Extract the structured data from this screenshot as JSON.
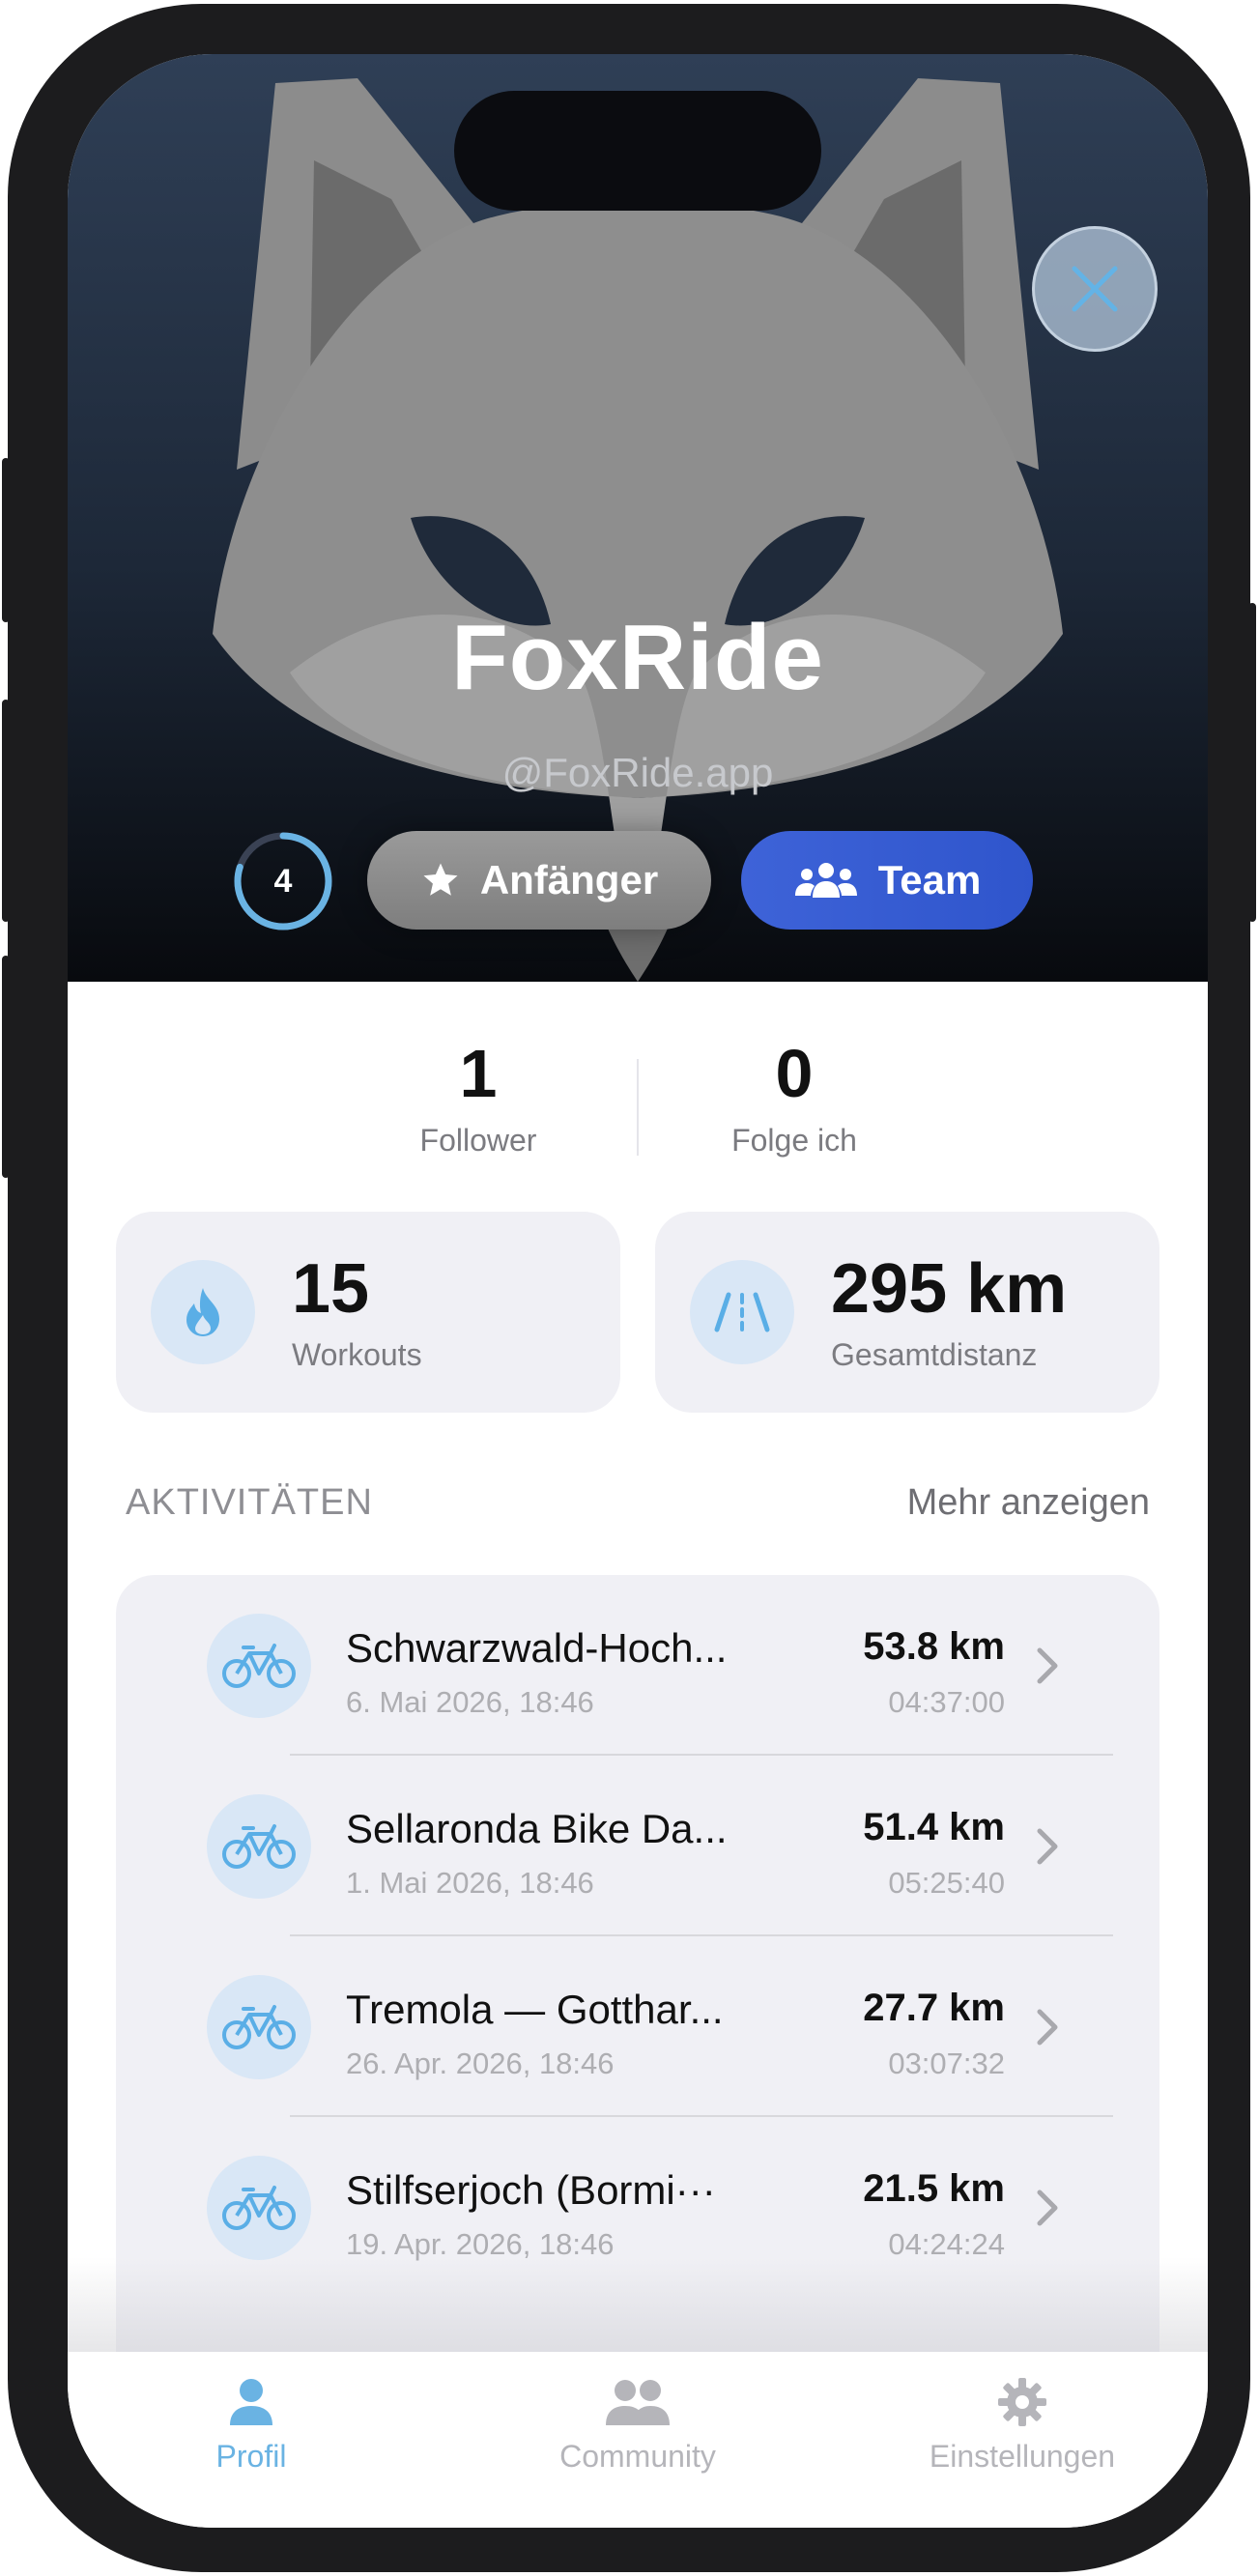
{
  "profile": {
    "name": "FoxRide",
    "handle": "@FoxRide.app",
    "level": "4",
    "rank_label": "Anfänger",
    "team_label": "Team"
  },
  "social": {
    "followers_count": "1",
    "followers_label": "Follower",
    "following_count": "0",
    "following_label": "Folge ich"
  },
  "summary": {
    "workouts_value": "15",
    "workouts_label": "Workouts",
    "distance_value": "295 km",
    "distance_label": "Gesamtdistanz"
  },
  "activities": {
    "title": "AKTIVITÄTEN",
    "more_label": "Mehr anzeigen",
    "items": [
      {
        "name": "Schwarzwald-Hoch...",
        "date": "6. Mai 2026, 18:46",
        "distance": "53.8 km",
        "duration": "04:37:00"
      },
      {
        "name": "Sellaronda Bike Da...",
        "date": "1. Mai 2026, 18:46",
        "distance": "51.4 km",
        "duration": "05:25:40"
      },
      {
        "name": "Tremola — Gotthar...",
        "date": "26. Apr. 2026, 18:46",
        "distance": "27.7 km",
        "duration": "03:07:32"
      },
      {
        "name": "Stilfserjoch (Bormi···",
        "date": "19. Apr. 2026, 18:46",
        "distance": "21.5 km",
        "duration": "04:24:24"
      }
    ]
  },
  "tabs": [
    {
      "label": "Profil",
      "icon": "person-icon",
      "active": true
    },
    {
      "label": "Community",
      "icon": "people-icon",
      "active": false
    },
    {
      "label": "Einstellungen",
      "icon": "gear-icon",
      "active": false
    }
  ],
  "colors": {
    "accent": "#6ab3e3",
    "team": "#3e63d8",
    "card_bg": "#f0f0f5"
  }
}
